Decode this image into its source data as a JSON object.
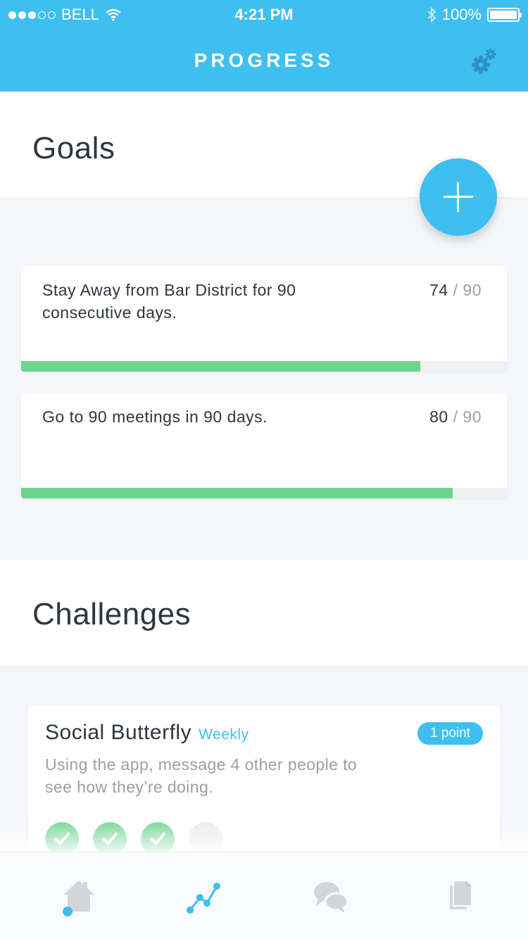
{
  "status_bar": {
    "carrier": "BELL",
    "signal_filled": 3,
    "signal_total": 5,
    "time": "4:21 PM",
    "battery": "100%",
    "battery_level": 1.0
  },
  "nav": {
    "title": "PROGRESS",
    "settings_icon": "gear-icon"
  },
  "goals": {
    "heading": "Goals",
    "add_icon": "plus-icon",
    "items": [
      {
        "text": "Stay Away from Bar District for 90 consecutive days.",
        "current": "74",
        "separator": "/",
        "total": "90",
        "progress": 0.822
      },
      {
        "text": "Go to 90 meetings in 90 days.",
        "current": "80",
        "separator": "/",
        "total": "90",
        "progress": 0.889
      }
    ]
  },
  "challenges": {
    "heading": "Challenges",
    "items": [
      {
        "name": "Social Butterfly",
        "frequency": "Weekly",
        "points": "1 point",
        "description": "Using the app, message 4 other people to see how they’re doing.",
        "completed": 3,
        "total": 4
      }
    ]
  },
  "tab_bar": {
    "tabs": [
      {
        "icon": "home-icon",
        "active": false
      },
      {
        "icon": "progress-chart-icon",
        "active": true
      },
      {
        "icon": "chat-icon",
        "active": false
      },
      {
        "icon": "documents-icon",
        "active": false
      }
    ]
  },
  "colors": {
    "accent": "#3ebff0",
    "success": "#6dd48e",
    "muted": "#9aa0a6",
    "text": "#2f3640",
    "inactive_icon": "#d3d6da"
  }
}
